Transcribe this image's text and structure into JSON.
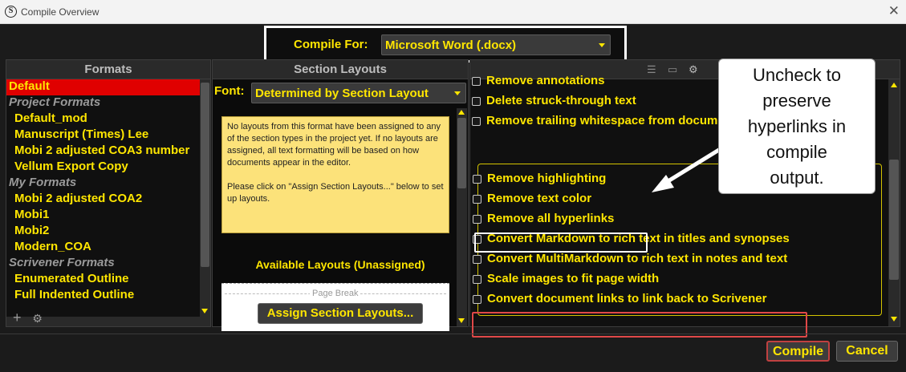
{
  "window": {
    "title": "Compile Overview",
    "app_icon": "S",
    "close_label": "✕"
  },
  "compile_for": {
    "label": "Compile For:",
    "value": "Microsoft Word (.docx)"
  },
  "formats": {
    "header": "Formats",
    "items": [
      {
        "label": "Default",
        "kind": "item",
        "selected": true
      },
      {
        "label": "Project Formats",
        "kind": "group"
      },
      {
        "label": "Default_mod",
        "kind": "item"
      },
      {
        "label": "Manuscript (Times) Lee",
        "kind": "item"
      },
      {
        "label": "Mobi 2 adjusted COA3 number",
        "kind": "item"
      },
      {
        "label": "Vellum Export Copy",
        "kind": "item"
      },
      {
        "label": "My Formats",
        "kind": "group"
      },
      {
        "label": "Mobi 2 adjusted COA2",
        "kind": "item"
      },
      {
        "label": "Mobi1",
        "kind": "item"
      },
      {
        "label": "Mobi2",
        "kind": "item"
      },
      {
        "label": "Modern_COA",
        "kind": "item"
      },
      {
        "label": "Scrivener Formats",
        "kind": "group"
      },
      {
        "label": "Enumerated Outline",
        "kind": "item"
      },
      {
        "label": "Full Indented Outline",
        "kind": "item"
      }
    ],
    "add_label": "+",
    "gear_label": "⚙"
  },
  "sections": {
    "header": "Section Layouts",
    "font_label": "Font:",
    "font_value": "Determined by Section Layout",
    "note_p1": "No layouts from this format have been assigned to any of the section types in the project yet. If no layouts are assigned, all text formatting will be based on how documents appear in the editor.",
    "note_p2": "Please click on \"Assign Section Layouts...\" below to set up layouts.",
    "available_label": "Available Layouts (Unassigned)",
    "page_break_label": "Page Break",
    "assign_button": "Assign Section Layouts..."
  },
  "options": {
    "top": [
      {
        "label": "Remove annotations"
      },
      {
        "label": "Delete struck-through text"
      },
      {
        "label": "Remove trailing whitespace from documents"
      }
    ],
    "group": [
      {
        "label": "Remove highlighting"
      },
      {
        "label": "Remove text color"
      },
      {
        "label": "Remove all hyperlinks"
      },
      {
        "label": "Convert Markdown to rich text in titles and synopses"
      },
      {
        "label": "Convert MultiMarkdown to rich text in notes and text"
      },
      {
        "label": "Scale images to fit page width"
      },
      {
        "label": "Convert document links to link back to Scrivener"
      }
    ]
  },
  "annotation": {
    "line1": "Uncheck to",
    "line2": "preserve",
    "line3": "hyperlinks in",
    "line4": "compile",
    "line5": "output."
  },
  "footer": {
    "compile": "Compile",
    "cancel": "Cancel"
  },
  "colors": {
    "accent": "#ffe600",
    "selected": "#e00000",
    "background": "#1b1b1b"
  }
}
